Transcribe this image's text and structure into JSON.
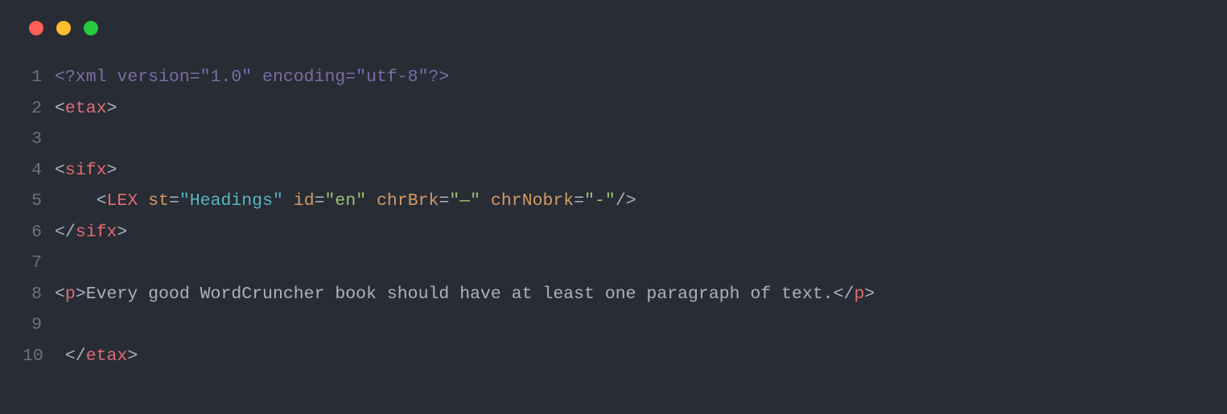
{
  "window": {
    "traffic_lights": {
      "close_color": "#ff5f56",
      "minimize_color": "#ffbd2e",
      "zoom_color": "#27c93f"
    }
  },
  "code": {
    "lines": [
      {
        "num": "1",
        "tokens": [
          {
            "t": "<?xml version=\"1.0\" encoding=\"utf-8\"?>",
            "c": "tok-xml-prolog"
          }
        ]
      },
      {
        "num": "2",
        "tokens": [
          {
            "t": "<",
            "c": "tok-tag-angle"
          },
          {
            "t": "etax",
            "c": "tok-tag-name"
          },
          {
            "t": ">",
            "c": "tok-tag-angle"
          }
        ]
      },
      {
        "num": "3",
        "tokens": []
      },
      {
        "num": "4",
        "tokens": [
          {
            "t": "<",
            "c": "tok-tag-angle"
          },
          {
            "t": "sifx",
            "c": "tok-tag-name"
          },
          {
            "t": ">",
            "c": "tok-tag-angle"
          }
        ]
      },
      {
        "num": "5",
        "tokens": [
          {
            "t": "    ",
            "c": "tok-text"
          },
          {
            "t": "<",
            "c": "tok-tag-angle"
          },
          {
            "t": "LEX",
            "c": "tok-tag-name"
          },
          {
            "t": " ",
            "c": "tok-text"
          },
          {
            "t": "st",
            "c": "tok-attr-name"
          },
          {
            "t": "=",
            "c": "tok-attr-eq"
          },
          {
            "t": "\"Headings\"",
            "c": "tok-attr-val-cyan"
          },
          {
            "t": " ",
            "c": "tok-text"
          },
          {
            "t": "id",
            "c": "tok-attr-name"
          },
          {
            "t": "=",
            "c": "tok-attr-eq"
          },
          {
            "t": "\"en\"",
            "c": "tok-attr-val"
          },
          {
            "t": " ",
            "c": "tok-text"
          },
          {
            "t": "chrBrk",
            "c": "tok-attr-name"
          },
          {
            "t": "=",
            "c": "tok-attr-eq"
          },
          {
            "t": "\"—\"",
            "c": "tok-attr-val"
          },
          {
            "t": " ",
            "c": "tok-text"
          },
          {
            "t": "chrNobrk",
            "c": "tok-attr-name"
          },
          {
            "t": "=",
            "c": "tok-attr-eq"
          },
          {
            "t": "\"-\"",
            "c": "tok-attr-val"
          },
          {
            "t": "/>",
            "c": "tok-tag-angle"
          }
        ]
      },
      {
        "num": "6",
        "tokens": [
          {
            "t": "</",
            "c": "tok-tag-angle"
          },
          {
            "t": "sifx",
            "c": "tok-tag-name"
          },
          {
            "t": ">",
            "c": "tok-tag-angle"
          }
        ]
      },
      {
        "num": "7",
        "tokens": []
      },
      {
        "num": "8",
        "tokens": [
          {
            "t": "<",
            "c": "tok-tag-angle"
          },
          {
            "t": "p",
            "c": "tok-tag-name"
          },
          {
            "t": ">",
            "c": "tok-tag-angle"
          },
          {
            "t": "Every good WordCruncher book should have at least one paragraph of text.",
            "c": "tok-text"
          },
          {
            "t": "</",
            "c": "tok-tag-angle"
          },
          {
            "t": "p",
            "c": "tok-tag-name"
          },
          {
            "t": ">",
            "c": "tok-tag-angle"
          }
        ]
      },
      {
        "num": "9",
        "tokens": []
      },
      {
        "num": "10",
        "tokens": [
          {
            "t": " ",
            "c": "tok-text"
          },
          {
            "t": "</",
            "c": "tok-tag-angle"
          },
          {
            "t": "etax",
            "c": "tok-tag-name"
          },
          {
            "t": ">",
            "c": "tok-tag-angle"
          }
        ]
      }
    ]
  }
}
